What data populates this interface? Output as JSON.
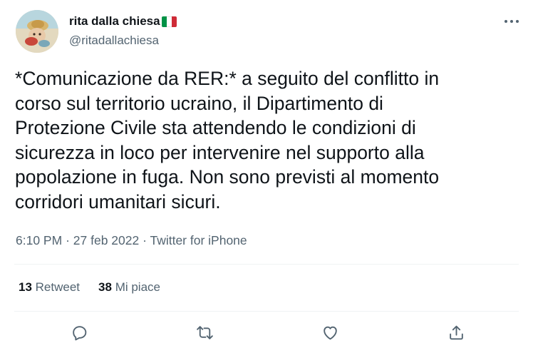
{
  "author": {
    "display_name": "rita dalla chiesa",
    "handle": "@ritadallachiesa",
    "flag_icon": "italy-flag-icon"
  },
  "tweet": {
    "text": "*Comunicazione da RER:* a seguito del conflitto in\ncorso sul territorio ucraino, il Dipartimento di\nProtezione Civile sta attendendo le condizioni di\nsicurezza in loco per intervenire nel supporto alla\npopolazione in fuga. Non sono previsti al momento\ncorridori umanitari sicuri.",
    "time": "6:10 PM",
    "date": "27 feb 2022",
    "source": "Twitter for iPhone"
  },
  "stats": {
    "retweets_count": "13",
    "retweets_label": "Retweet",
    "likes_count": "38",
    "likes_label": "Mi piace"
  },
  "actions": [
    "reply-icon",
    "retweet-icon",
    "like-icon",
    "share-icon"
  ],
  "colors": {
    "text": "#0f1419",
    "secondary": "#536471",
    "divider": "#eff3f4",
    "flag_green": "#009246",
    "flag_white": "#ffffff",
    "flag_red": "#ce2b37"
  }
}
